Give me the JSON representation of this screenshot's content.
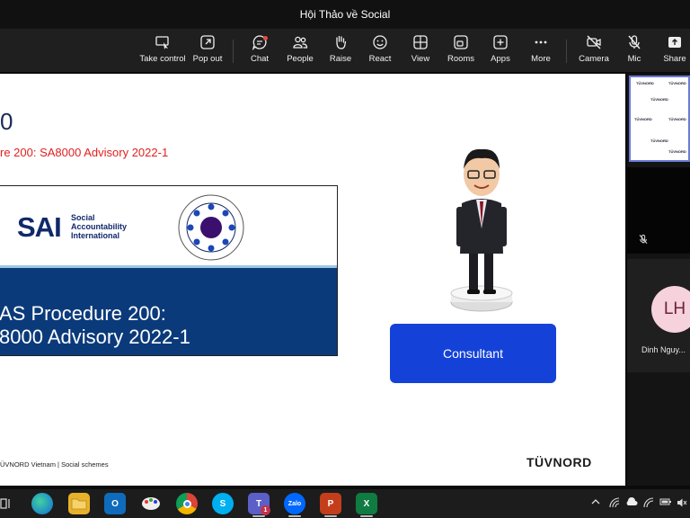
{
  "window": {
    "title": "Hội Thảo về Social"
  },
  "toolbar": {
    "take_control": "Take control",
    "pop_out": "Pop out",
    "chat": "Chat",
    "people": "People",
    "raise": "Raise",
    "react": "React",
    "view": "View",
    "rooms": "Rooms",
    "apps": "Apps",
    "more": "More",
    "camera": "Camera",
    "mic": "Mic",
    "share": "Share"
  },
  "slide": {
    "number_fragment": "0",
    "subtitle": "re 200: SA8000 Advisory 2022-1",
    "sai_logo": "SAI",
    "sai_text": "Social Accountability International",
    "procedure_line1": "AS Procedure 200:",
    "procedure_line2": "8000 Advisory 2022-1",
    "consultant": "Consultant",
    "footer_left": "ÜVNORD Vietnam | Social schemes",
    "footer_right": "TÜVNORD"
  },
  "participants": {
    "thumb_logo": "TÜVNORD",
    "person_initials": "LH",
    "person_name": "Dinh Nguy..."
  },
  "taskbar": {
    "outlook": "O",
    "skype": "S",
    "teams": "T",
    "teams_badge": "1",
    "zalo": "Zalo",
    "powerpoint": "P",
    "excel": "X"
  },
  "colors": {
    "accent_blue": "#1442d9",
    "slide_navy": "#0b3a7a",
    "sai_blue": "#11286b",
    "red_text": "#e02020"
  }
}
